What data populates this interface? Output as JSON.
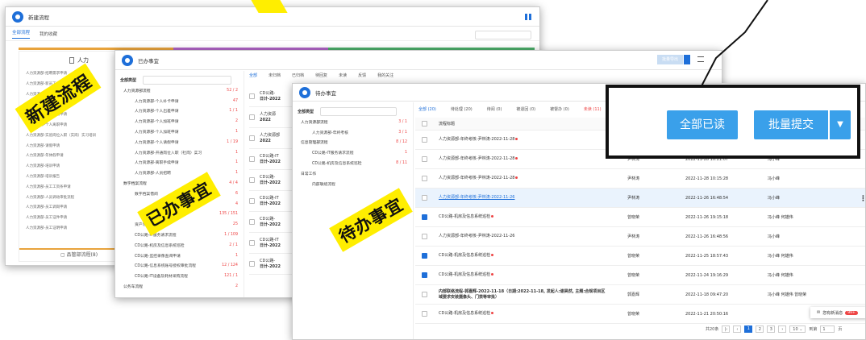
{
  "w1": {
    "title": "新建流程",
    "tabs": [
      "全部流程",
      "我的收藏"
    ],
    "category": "人力",
    "bottom": "品管部流程(8)",
    "items": [
      "人力资源部-招聘需求申请",
      "人力资源部-新员工入职申请",
      "人力资源部-员工转正申请",
      "人力资源部-个人调薪申请",
      "人力资源部-员工异动申请",
      "人力资源部-个人离职申请",
      "人力资源部-实验岗位入职（实岗）实习培训",
      "人力资源部-请假申请",
      "人力资源部-年休假申请",
      "人力资源部-培训申请",
      "人力资源部-培训报告",
      "人力资源部-员工工资条申请",
      "人力资源部-人员调动审批流程",
      "人力资源部-员工调岗申请",
      "人力资源部-员工证件申请",
      "人力资源部-员工证明申请"
    ]
  },
  "w2": {
    "title": "已办事宜",
    "tabs": [
      "全部",
      "未归档",
      "已归档",
      "待回复",
      "未读",
      "反馈",
      "我的关注"
    ],
    "export": "批量导出",
    "tree_head": "全部类型",
    "col": "流程标题",
    "tree": [
      {
        "l": "人力资源部流程",
        "c": "52 / 2",
        "top": true
      },
      {
        "l": "人力资源部-个人补卡申请",
        "c": "47"
      },
      {
        "l": "人力资源部-个人出差申请",
        "c": "1 / 1"
      },
      {
        "l": "人力资源部-个人加班申请",
        "c": "2"
      },
      {
        "l": "人力资源部-个人加班申请",
        "c": "1"
      },
      {
        "l": "人力资源部-个人请假申请",
        "c": "1 / 19"
      },
      {
        "l": "人力资源部-开通岗位入职（社岗）实习",
        "c": "1"
      },
      {
        "l": "人力资源部-离职手续申请",
        "c": "1"
      },
      {
        "l": "人力资源部-人员招聘",
        "c": "1"
      },
      {
        "l": "数字档案流程",
        "c": "4 / 4",
        "top": true
      },
      {
        "l": "数字档案借阅",
        "c": "6"
      },
      {
        "l": "",
        "c": "4"
      },
      {
        "l": "",
        "c": "135 / 151",
        "top": true
      },
      {
        "l": "资产领用流程",
        "c": "25"
      },
      {
        "l": "CD公路-IT服务请求流程",
        "c": "1 / 109"
      },
      {
        "l": "CD公路-机房及信息系统巡检",
        "c": "2 / 1"
      },
      {
        "l": "CD公路-监控录像查阅申请",
        "c": "1"
      },
      {
        "l": "CD公路-信息系统账号授权审批流程",
        "c": "12 / 124"
      },
      {
        "l": "CD公路-IT设备及耗材采购流程",
        "c": "121 / 1"
      },
      {
        "l": "公务车流程",
        "c": "2",
        "top": true
      }
    ],
    "rows": [
      {
        "a": "CD公路-",
        "b": "日计-2022"
      },
      {
        "a": "人力资源",
        "b": "2022"
      },
      {
        "a": "人力资源部",
        "b": "2022"
      },
      {
        "a": "CD公路-IT",
        "b": "日计-2022"
      },
      {
        "a": "CD公路-",
        "b": "日计-2022"
      },
      {
        "a": "CD公路-IT",
        "b": "日计-2022"
      },
      {
        "a": "CD公路-",
        "b": "日计-2022"
      },
      {
        "a": "CD公路-IT",
        "b": "日计-2022"
      },
      {
        "a": "CD公路-",
        "b": "日计-2022"
      }
    ]
  },
  "w3": {
    "title": "待办事宜",
    "tree_head": "全部类型",
    "col": "流程标题",
    "tabs": [
      "全部 (20)",
      "待处理 (20)",
      "待阅 (0)",
      "被退回 (0)",
      "被督办 (0)",
      "未读 (11)"
    ],
    "tree": [
      {
        "l": "人力资源部流程",
        "c": "3 / 1",
        "top": true
      },
      {
        "l": "人力资源部-年终考核",
        "c": "3 / 1"
      },
      {
        "l": "信息管理部流程",
        "c": "8 / 12",
        "top": true
      },
      {
        "l": "CD公路-IT服务请求流程",
        "c": "1"
      },
      {
        "l": "CD公路-机房及信息系统巡检",
        "c": "8 / 11"
      },
      {
        "l": "日常工作",
        "c": "",
        "top": true
      },
      {
        "l": "内部联络流程",
        "c": ""
      }
    ],
    "rows": [
      {
        "t": "人力资源部-年终考核-尹林涛-2022-11-28",
        "dot": true,
        "p": "",
        "d": "",
        "n": "",
        "cb": false
      },
      {
        "t": "人力资源部-年终考核-尹林涛-2022-11-28",
        "dot": true,
        "p": "尹林涛",
        "d": "2022-11-28 10:21:07",
        "n": "冯小峰",
        "cb": false
      },
      {
        "t": "人力资源部-年终考核-尹林涛-2022-11-28",
        "dot": true,
        "p": "尹林涛",
        "d": "2022-11-28 10:15:28",
        "n": "冯小峰",
        "cb": false
      },
      {
        "t": "人力资源部-年终考核-尹林涛-2022-11-26",
        "dot": false,
        "p": "尹林涛",
        "d": "2022-11-26 16:48:54",
        "n": "冯小峰",
        "cb": false,
        "link": true
      },
      {
        "t": "CD公路-机房及信息系统巡检",
        "dot": true,
        "p": "曾晓荣",
        "d": "2022-11-26 19:15:18",
        "n": "冯小峰 何雄伟",
        "cb": true
      },
      {
        "t": "人力资源部-年终考核-尹林涛-2022-11-26",
        "dot": false,
        "p": "尹林涛",
        "d": "2022-11-26 16:48:56",
        "n": "冯小峰",
        "cb": false
      },
      {
        "t": "CD公路-机房及信息系统巡检",
        "dot": true,
        "p": "曾晓荣",
        "d": "2022-11-25 18:57:43",
        "n": "冯小峰 何雄伟",
        "cb": true
      },
      {
        "t": "CD公路-机房及信息系统巡检",
        "dot": true,
        "p": "曾晓荣",
        "d": "2022-11-24 19:16:29",
        "n": "冯小峰 何雄伟",
        "cb": true
      },
      {
        "t": "内部联络流程-郭嘉辉-2022-11-18（日期:2022-11-18, 发起人:谢昊然, 主题:合规项目区域要求安装摄像头、门禁等审批）",
        "dot": false,
        "p": "郭嘉辉",
        "d": "2022-11-18 09:47:20",
        "n": "冯小峰 何雄伟 曾晓荣",
        "cb": false,
        "bold": true
      },
      {
        "t": "CD公路-机房及信息系统巡检",
        "dot": true,
        "p": "曾晓荣",
        "d": "2022-11-21 20:50:16",
        "n": "",
        "cb": false
      }
    ],
    "footer": {
      "total": "共20条",
      "pages": [
        "1",
        "2",
        "3"
      ],
      "size": "10",
      "goto": "到第",
      "goto_val": "1",
      "page_unit": "页"
    },
    "toast": {
      "text": "您有新消息",
      "badge": "99+"
    }
  },
  "callout": {
    "read_all": "全部已读",
    "batch": "批量提交"
  },
  "stamps": {
    "s1": "新建流程",
    "s2": "已办事宜",
    "s3": "待办事宜"
  },
  "colors": {
    "primary": "#1e6fd9",
    "callout_btn": "#3aa0ea",
    "stamp": "#ffee00"
  }
}
